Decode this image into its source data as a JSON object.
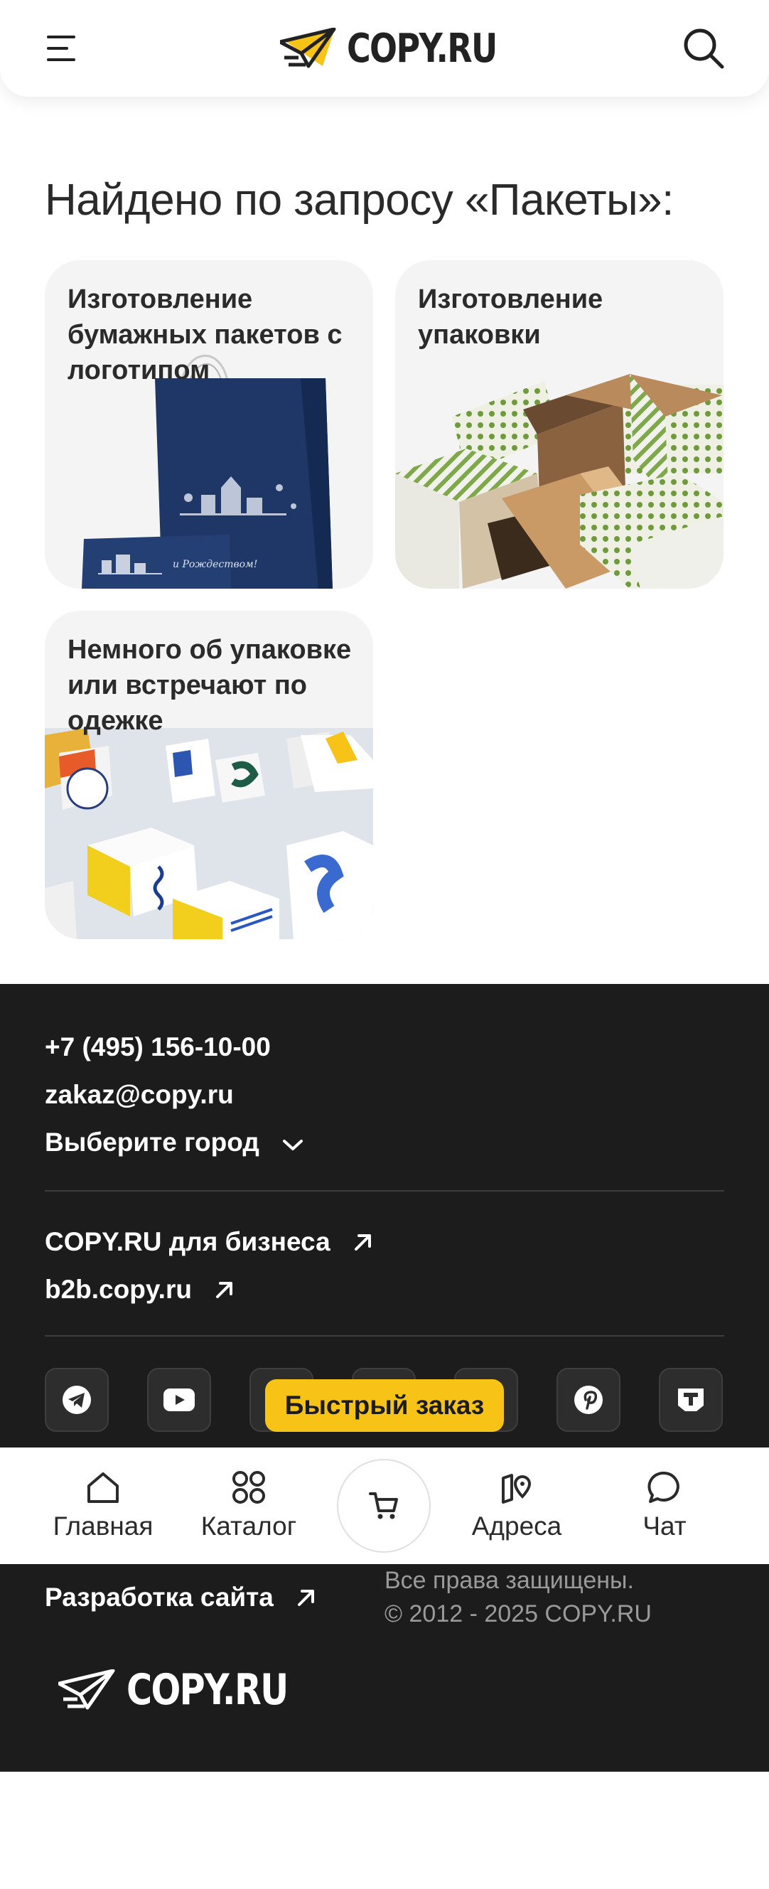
{
  "header": {
    "logo_text": "COPY.RU"
  },
  "search": {
    "title": "Найдено по запросу «Пакеты»:"
  },
  "cards": [
    {
      "title": "Изготовление бумажных пакетов с логотипом"
    },
    {
      "title": "Изготовление упаковки"
    },
    {
      "title": "Немного об упаковке или встречают по одежке"
    }
  ],
  "footer": {
    "phone": "+7 (495) 156-10-00",
    "email": "zakaz@copy.ru",
    "city_select": "Выберите город",
    "business_link": "COPY.RU для бизнеса",
    "b2b_link": "b2b.copy.ru",
    "quick_order": "Быстрый заказ",
    "dev_link": "Разработка сайта",
    "rights": "Все права защищены.",
    "copyright": "© 2012 - 2025 COPY.RU",
    "logo_text": "COPY.RU"
  },
  "bottom_nav": {
    "home": "Главная",
    "catalog": "Каталог",
    "addresses": "Адреса",
    "chat": "Чат"
  },
  "colors": {
    "accent": "#f7c316",
    "footer_bg": "#1c1c1c",
    "card_bg": "#f4f4f4"
  }
}
